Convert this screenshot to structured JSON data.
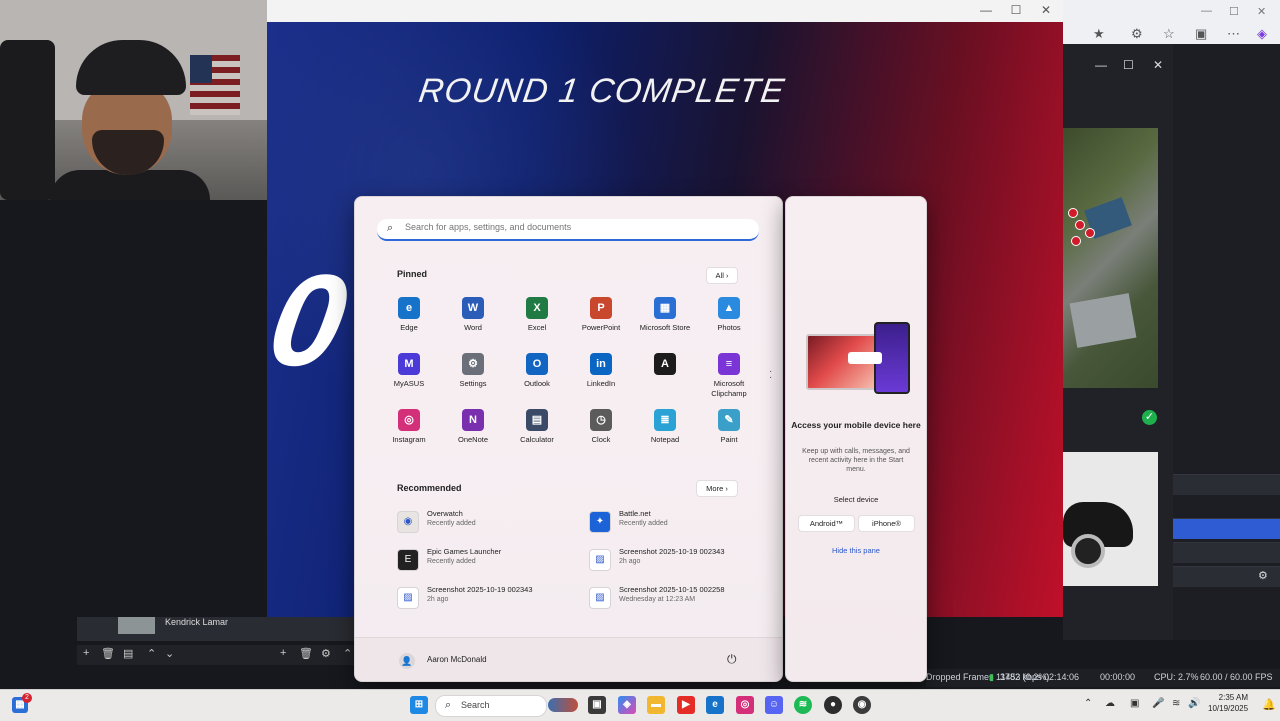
{
  "game": {
    "round_title": "ROUND 1 COMPLETE",
    "big_score": "0"
  },
  "obs": {
    "scene_label": "Kendrick Lamar",
    "status": {
      "frames": "Dropped Frames 11453 (0.2%)",
      "bitrate": "3782 kbps",
      "live_time": "02:14:06",
      "rec_time": "00:00:00",
      "cpu": "CPU: 2.7%",
      "fps": "60.00 / 60.00 FPS"
    }
  },
  "start_menu": {
    "search_placeholder": "Search for apps, settings, and documents",
    "pinned_title": "Pinned",
    "all_button": "All",
    "pinned": [
      {
        "label": "Edge",
        "icon": "edge-icon",
        "color": "#1673c9",
        "glyph": "e"
      },
      {
        "label": "Word",
        "icon": "word-icon",
        "color": "#2b5cb8",
        "glyph": "W"
      },
      {
        "label": "Excel",
        "icon": "excel-icon",
        "color": "#1f7a44",
        "glyph": "X"
      },
      {
        "label": "PowerPoint",
        "icon": "powerpoint-icon",
        "color": "#c8472d",
        "glyph": "P"
      },
      {
        "label": "Microsoft Store",
        "icon": "store-icon",
        "color": "#2a6fd3",
        "glyph": "▦"
      },
      {
        "label": "Photos",
        "icon": "photos-icon",
        "color": "#2a8ae0",
        "glyph": "▲"
      },
      {
        "label": "MyASUS",
        "icon": "myasus-icon",
        "color": "#4b3ad8",
        "glyph": "M"
      },
      {
        "label": "Settings",
        "icon": "settings-icon",
        "color": "#6a6f7a",
        "glyph": "⚙"
      },
      {
        "label": "Outlook",
        "icon": "outlook-icon",
        "color": "#1266c2",
        "glyph": "O"
      },
      {
        "label": "LinkedIn",
        "icon": "linkedin-icon",
        "color": "#0a66c2",
        "glyph": "in"
      },
      {
        "label": "",
        "icon": "adobe-icon",
        "color": "#1c1c1c",
        "glyph": "A"
      },
      {
        "label": "Microsoft Clipchamp",
        "icon": "clipchamp-icon",
        "color": "#7b35d6",
        "glyph": "≡"
      },
      {
        "label": "Instagram",
        "icon": "instagram-icon",
        "color": "#d4307a",
        "glyph": "◎"
      },
      {
        "label": "OneNote",
        "icon": "onenote-icon",
        "color": "#7a2fae",
        "glyph": "N"
      },
      {
        "label": "Calculator",
        "icon": "calculator-icon",
        "color": "#3b4a66",
        "glyph": "▤"
      },
      {
        "label": "Clock",
        "icon": "clock-icon",
        "color": "#5b5b5b",
        "glyph": "◷"
      },
      {
        "label": "Notepad",
        "icon": "notepad-icon",
        "color": "#2aa2d6",
        "glyph": "≣"
      },
      {
        "label": "Paint",
        "icon": "paint-icon",
        "color": "#3aa0c9",
        "glyph": "✎"
      }
    ],
    "recommended_title": "Recommended",
    "more_button": "More",
    "recommended": [
      {
        "name": "Overwatch",
        "sub": "Recently added",
        "icon": "overwatch-icon",
        "color": "#e8e4e2",
        "glyph": "◉"
      },
      {
        "name": "Battle.net",
        "sub": "Recently added",
        "icon": "battlenet-icon",
        "color": "#1b63d6",
        "glyph": "✦"
      },
      {
        "name": "Epic Games Launcher",
        "sub": "Recently added",
        "icon": "epic-icon",
        "color": "#222222",
        "glyph": "E"
      },
      {
        "name": "Screenshot 2025-10-19 002343",
        "sub": "2h ago",
        "icon": "image-file-icon",
        "color": "#ffffff",
        "glyph": "▨"
      },
      {
        "name": "Screenshot 2025-10-19 002343",
        "sub": "2h ago",
        "icon": "image-file-icon",
        "color": "#ffffff",
        "glyph": "▨"
      },
      {
        "name": "Screenshot 2025-10-15 002258",
        "sub": "Wednesday at 12:23 AM",
        "icon": "image-file-icon",
        "color": "#ffffff",
        "glyph": "▨"
      }
    ],
    "user_name": "Aaron McDonald"
  },
  "phone_pane": {
    "title": "Access your mobile device here",
    "description": "Keep up with calls, messages, and recent activity here in the Start menu.",
    "select_label": "Select device",
    "android_button": "Android™",
    "iphone_button": "iPhone®",
    "hide_link": "Hide this pane"
  },
  "taskbar": {
    "search_label": "Search",
    "time": "2:35 AM",
    "date": "10/19/2025",
    "notification_count": "2"
  }
}
